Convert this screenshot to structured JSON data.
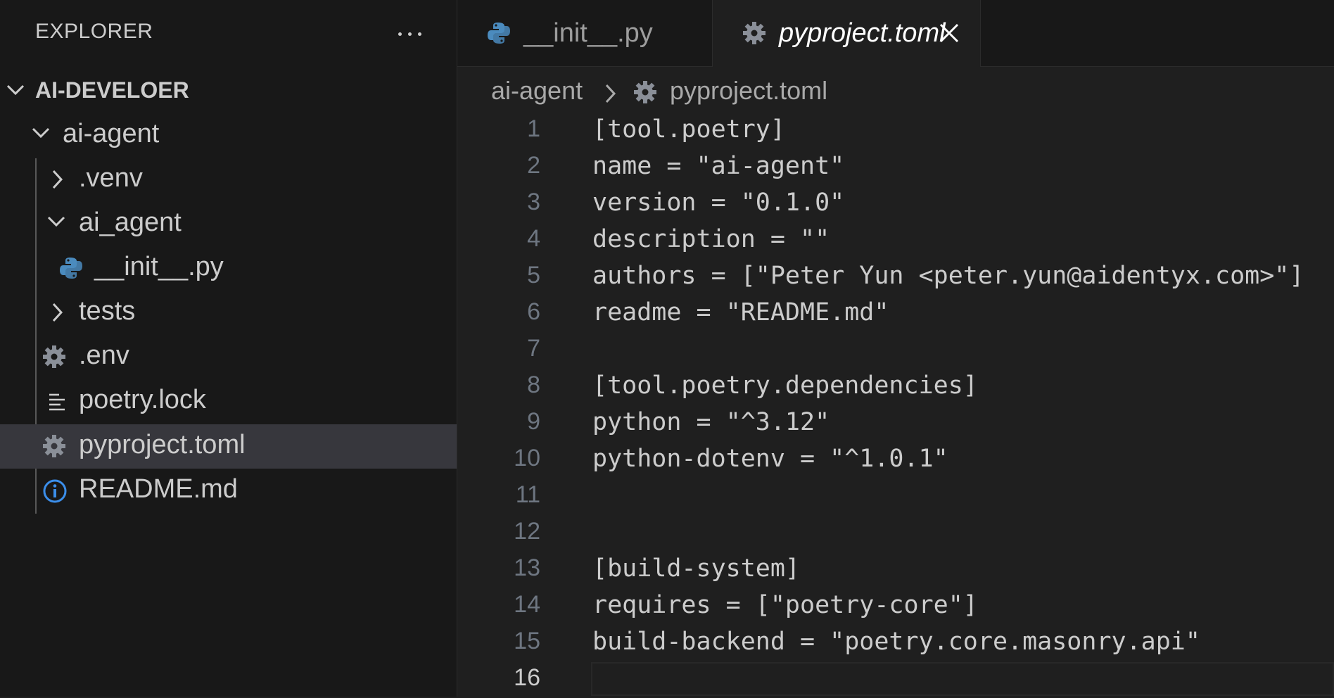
{
  "explorer": {
    "title": "EXPLORER",
    "more_icon": "ellipsis-icon",
    "workspace": "AI-DEVELOER",
    "items": [
      {
        "label": "ai-agent",
        "kind": "folder-open"
      },
      {
        "label": ".venv",
        "kind": "folder-closed"
      },
      {
        "label": "ai_agent",
        "kind": "folder-open"
      },
      {
        "label": "__init__.py",
        "kind": "python-file"
      },
      {
        "label": "tests",
        "kind": "folder-closed"
      },
      {
        "label": ".env",
        "kind": "settings-file"
      },
      {
        "label": "poetry.lock",
        "kind": "text-file"
      },
      {
        "label": "pyproject.toml",
        "kind": "settings-file",
        "selected": true
      },
      {
        "label": "README.md",
        "kind": "info-file"
      }
    ]
  },
  "tabs": [
    {
      "label": "__init__.py",
      "icon": "python-icon",
      "active": false
    },
    {
      "label": "pyproject.toml",
      "icon": "gear-icon",
      "active": true,
      "close_icon": "close-icon"
    }
  ],
  "breadcrumb": {
    "folder": "ai-agent",
    "file": "pyproject.toml"
  },
  "editor": {
    "current_line": 16,
    "lines": [
      {
        "n": "1",
        "text": "[tool.poetry]"
      },
      {
        "n": "2",
        "text": "name = \"ai-agent\""
      },
      {
        "n": "3",
        "text": "version = \"0.1.0\""
      },
      {
        "n": "4",
        "text": "description = \"\""
      },
      {
        "n": "5",
        "text": "authors = [\"Peter Yun <peter.yun@aidentyx.com>\"]"
      },
      {
        "n": "6",
        "text": "readme = \"README.md\""
      },
      {
        "n": "7",
        "text": ""
      },
      {
        "n": "8",
        "text": "[tool.poetry.dependencies]"
      },
      {
        "n": "9",
        "text": "python = \"^3.12\""
      },
      {
        "n": "10",
        "text": "python-dotenv = \"^1.0.1\""
      },
      {
        "n": "11",
        "text": ""
      },
      {
        "n": "12",
        "text": ""
      },
      {
        "n": "13",
        "text": "[build-system]"
      },
      {
        "n": "14",
        "text": "requires = [\"poetry-core\"]"
      },
      {
        "n": "15",
        "text": "build-backend = \"poetry.core.masonry.api\""
      },
      {
        "n": "16",
        "text": ""
      }
    ]
  },
  "colors": {
    "python_blue": "#4b8bbe",
    "python_yellow": "#ffd43b",
    "gear_gray": "#8a8f98",
    "info_blue": "#3b8eea",
    "selection": "#37373d"
  }
}
